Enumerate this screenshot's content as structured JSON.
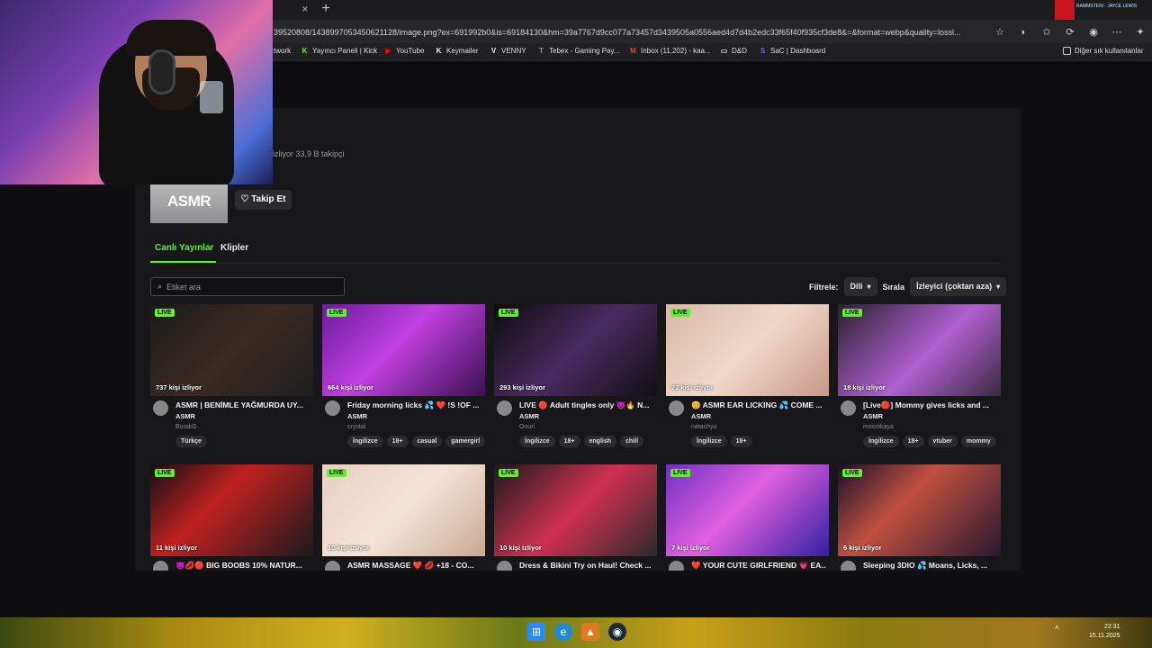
{
  "browser": {
    "tab_close": "×",
    "tab_new": "+",
    "extension_label": "RAMMSTEIN - JAYCE LEWIS",
    "url": "39520808/1438997053450621128/image.png?ex=691992b0&is=69184130&hm=39a7767d9cc077a73457d3439505a0556aed4d7d4b2edc33f65f40f935cf3de8&=&format=webp&quality=lossl...",
    "bookmarks": [
      {
        "label": "twork",
        "icon": "",
        "color": "#ffffff"
      },
      {
        "label": "Yayıncı Paneli | Kick",
        "icon": "K",
        "color": "#53fc18"
      },
      {
        "label": "YouTube",
        "icon": "▶",
        "color": "#ff0000"
      },
      {
        "label": "Keymailer",
        "icon": "K",
        "color": "#e8e8e8"
      },
      {
        "label": "VENNY",
        "icon": "V",
        "color": "#e8e8e8"
      },
      {
        "label": "Tebex - Gaming Pay...",
        "icon": "T",
        "color": "#2ec27e"
      },
      {
        "label": "Inbox (11,202) - kaa...",
        "icon": "M",
        "color": "#ea4335"
      },
      {
        "label": "D&D",
        "icon": "▭",
        "color": "#d0d0d0"
      },
      {
        "label": "SaC | Dashboard",
        "icon": "S",
        "color": "#7b5cff"
      }
    ],
    "other_bookmarks": "Diğer sık kullanılanlar"
  },
  "channel": {
    "stats": "izliyor   33,9 B takipçi",
    "logo_text": "ASMR",
    "follow_label": "♡  Takip Et"
  },
  "tabs": {
    "live": "Canlı Yayınlar",
    "clips": "Klipler"
  },
  "search": {
    "placeholder": "Etiket ara"
  },
  "filters": {
    "filter_label": "Filtrele:",
    "language": "Dili",
    "sort_label": "Sırala",
    "sort_value": "İzleyici (çoktan aza)"
  },
  "live_badge": "LIVE",
  "streams": [
    {
      "viewers": "737 kişi izliyor",
      "title": "ASMR | BENİMLE YAĞMURDA UY...",
      "category": "ASMR",
      "streamer": "BurakG",
      "tags": [
        "Türkçe"
      ],
      "thumb": "linear-gradient(135deg,#1a1a1a,#3a2a22 50%,#1e1e1e)"
    },
    {
      "viewers": "664 kişi izliyor",
      "title": "Friday morning licks 💦 ❤️ !S !OF ...",
      "category": "ASMR",
      "streamer": "crystal",
      "tags": [
        "İngilizce",
        "18+",
        "casual",
        "gamergirl"
      ],
      "thumb": "linear-gradient(135deg,#6a1a9a,#c040e0 45%,#3a1050)"
    },
    {
      "viewers": "293 kişi izliyor",
      "title": "LIVE 🔴 Adult tingles only 😈🔥 N...",
      "category": "ASMR",
      "streamer": "Onuri",
      "tags": [
        "İngilizce",
        "18+",
        "english",
        "chill"
      ],
      "thumb": "linear-gradient(135deg,#0c0c10,#4a2a60 50%,#101014)"
    },
    {
      "viewers": "72 kişi izliyor",
      "title": "😊 ASMR EAR LICKING 💦 COME ...",
      "category": "ASMR",
      "streamer": "natachyu",
      "tags": [
        "İngilizce",
        "18+"
      ],
      "thumb": "linear-gradient(135deg,#d8b8a8,#f0d8c8 50%,#c89888)"
    },
    {
      "viewers": "18 kişi izliyor",
      "title": "[Live🔴] Mommy gives licks and ...",
      "category": "ASMR",
      "streamer": "moonikaya",
      "tags": [
        "İngilizce",
        "18+",
        "vtuber",
        "mommy"
      ],
      "thumb": "linear-gradient(135deg,#2a2030,#b060d0 55%,#3a2a40)"
    },
    {
      "viewers": "11 kişi izliyor",
      "title": "😈💋🔴 BIG BOOBS 10% NATUR...",
      "category": "",
      "streamer": "",
      "tags": [],
      "thumb": "linear-gradient(135deg,#101012,#c02020 40%,#1a1a1c)"
    },
    {
      "viewers": "10 kişi izliyor",
      "title": "ASMR MASSAGE ❤️ 💋 +18 - CO...",
      "category": "",
      "streamer": "",
      "tags": [],
      "thumb": "linear-gradient(135deg,#e8d0c0,#f4e4d8 50%,#c8a890)"
    },
    {
      "viewers": "10 kişi izliyor",
      "title": "Dress & Bikini Try on Haul! Check ...",
      "category": "",
      "streamer": "",
      "tags": [],
      "thumb": "linear-gradient(135deg,#1a1a1c,#d03050 50%,#2a2a2c)"
    },
    {
      "viewers": "7 kişi izliyor",
      "title": "❤️ YOUR CUTE GIRLFRIEND 💗 EA...",
      "category": "",
      "streamer": "",
      "tags": [],
      "thumb": "linear-gradient(135deg,#7030c0,#e060e0 45%,#3020a0)"
    },
    {
      "viewers": "6 kişi izliyor",
      "title": "Sleeping 3DIO 💦 Moans, Licks, ...",
      "category": "",
      "streamer": "",
      "tags": [],
      "thumb": "linear-gradient(135deg,#1a1028,#c05040 40%,#281830)"
    }
  ],
  "tray": {
    "time": "22:31",
    "date": "15.11.2025"
  },
  "colors": {
    "accent": "#53fc18"
  }
}
